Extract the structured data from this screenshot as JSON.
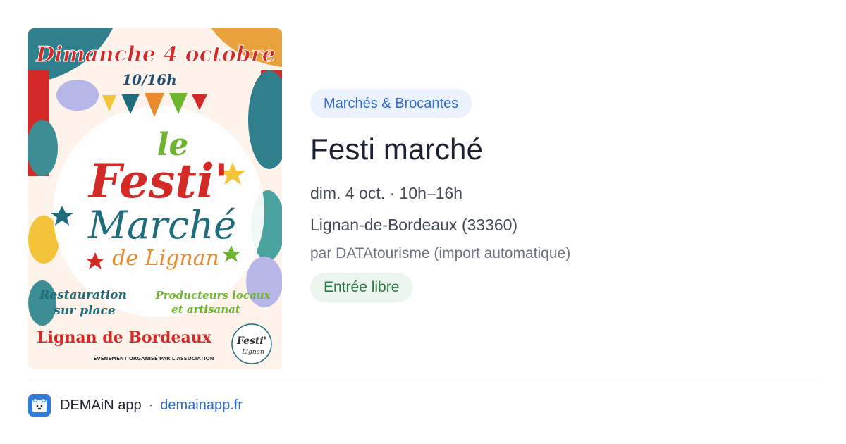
{
  "poster": {
    "headline_date": "Dimanche 4 octobre",
    "headline_hours": "10/16h",
    "title_le": "le",
    "title_festi": "Festi'",
    "title_marche": "Marché",
    "title_de_lignan": "de Lignan",
    "feature_left_1": "Restauration",
    "feature_left_2": "sur place",
    "feature_right_1": "Producteurs locaux",
    "feature_right_2": "et artisanat",
    "place": "Lignan de Bordeaux",
    "organised_by": "ÉVÉNEMENT ORGANISÉ PAR L'ASSOCIATION",
    "logo_text_1": "Festi'",
    "logo_text_2": "Lignan"
  },
  "event": {
    "category": "Marchés & Brocantes",
    "title": "Festi marché",
    "datetime": "dim. 4 oct. · 10h–16h",
    "location": "Lignan-de-Bordeaux (33360)",
    "organizer": "par DATAtourisme (import automatique)",
    "price": "Entrée libre"
  },
  "footer": {
    "app_name": "DEMAiN app",
    "separator": "·",
    "site": "demainapp.fr"
  },
  "colors": {
    "accent": "#2f6bd0",
    "category_bg": "#ebf2fd",
    "price_text": "#2a7a44",
    "price_bg": "#eaf6ee",
    "poster_red": "#d42a27",
    "poster_teal": "#1e6c7c",
    "poster_green": "#6fb431"
  },
  "icons": {
    "app": "bear-calendar-icon"
  }
}
